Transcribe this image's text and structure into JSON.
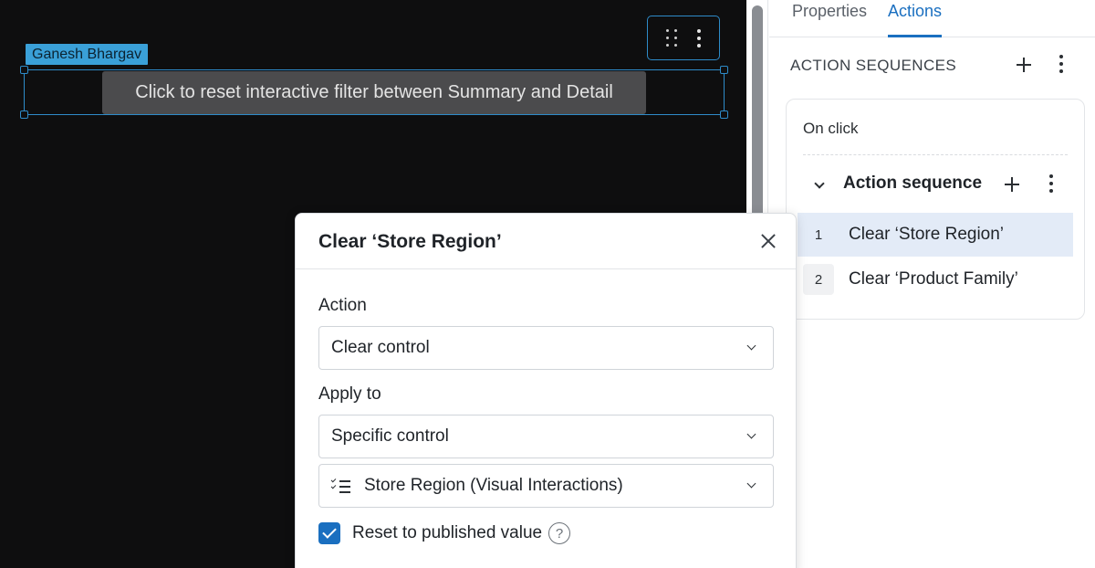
{
  "canvas": {
    "user_tag": "Ganesh Bhargav",
    "button_text": "Click to reset interactive filter between Summary and Detail",
    "toolbar_icons": [
      "drag-handle-icon",
      "more-vertical-icon"
    ]
  },
  "panel": {
    "tabs": [
      {
        "label": "Properties",
        "active": false
      },
      {
        "label": "Actions",
        "active": true
      }
    ],
    "section_title": "ACTION SEQUENCES",
    "trigger": "On click",
    "sequence": {
      "title": "Action sequence",
      "steps": [
        {
          "num": "1",
          "label": "Clear ‘Store Region’",
          "selected": true
        },
        {
          "num": "2",
          "label": "Clear ‘Product Family’",
          "selected": false
        }
      ]
    }
  },
  "dialog": {
    "title": "Clear ‘Store Region’",
    "action_label": "Action",
    "action_value": "Clear control",
    "apply_label": "Apply to",
    "apply_value": "Specific control",
    "control_value": "Store Region (Visual Interactions)",
    "checkbox_label": "Reset to published value",
    "checkbox_checked": true,
    "help_glyph": "?"
  },
  "colors": {
    "accent": "#1a6fc0",
    "selection": "#2e8bc9",
    "canvas_bg": "#0e0e0f",
    "user_tag_bg": "#3aa0d8",
    "selected_row": "#e3ebf7"
  }
}
